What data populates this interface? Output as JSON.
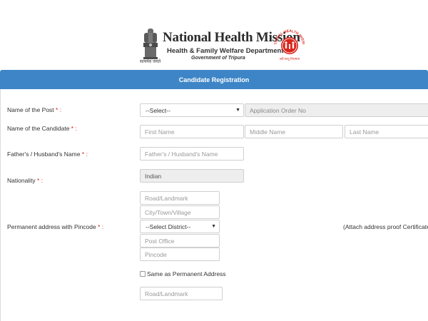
{
  "header": {
    "title": "National Health Mission",
    "department": "Health & Family Welfare Department",
    "government": "Government of Tripura",
    "emblem_caption": "सत्यमेव जयते",
    "logo_top_text": "NATIONAL HEALTH MISSION",
    "logo_bottom_text": "सर्वे सन्तु निरामया"
  },
  "form": {
    "heading": "Candidate Registration",
    "post": {
      "label": "Name of the Post",
      "required_mark": " * :",
      "select_value": "--Select--",
      "order_placeholder": "Application Order No"
    },
    "candidate": {
      "label": "Name of the Candidate",
      "required_mark": " * :",
      "first_placeholder": "First Name",
      "middle_placeholder": "Middle Name",
      "last_placeholder": "Last Name"
    },
    "guardian": {
      "label": "Father's / Husband's Name",
      "required_mark": " * :",
      "placeholder": "Father's / Husband's Name"
    },
    "nationality": {
      "label": "Nationality",
      "required_mark": " * :",
      "value": "Indian"
    },
    "permanent_address": {
      "label": "Permanent address with Pincode",
      "required_mark": " * :",
      "road_placeholder": "Road/Landmark",
      "city_placeholder": "City/Town/Village",
      "district_select": "--Select District--",
      "post_office_placeholder": "Post Office",
      "pincode_placeholder": "Pincode",
      "note": "(Attach address proof Certificate)"
    },
    "same_as_permanent": {
      "label": "Same as Permanent Address",
      "checked": false
    },
    "present_address": {
      "road_placeholder": "Road/Landmark"
    }
  },
  "colors": {
    "band": "#3d85c6",
    "required": "#e02020",
    "logo_red": "#d9261c"
  }
}
